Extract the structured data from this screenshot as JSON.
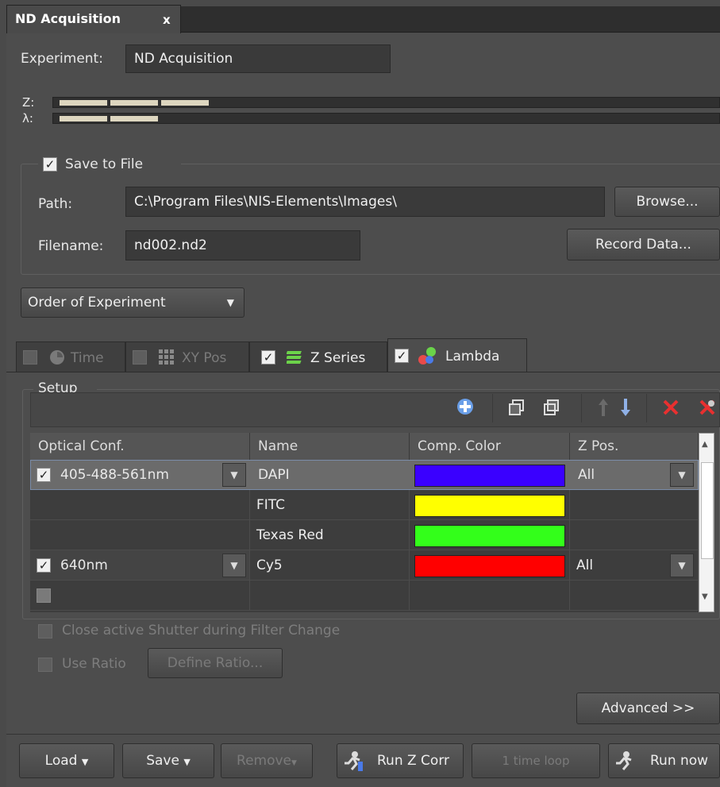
{
  "window": {
    "tab_title": "ND Acquisition",
    "tab_close": "x"
  },
  "experiment": {
    "label": "Experiment:",
    "value": "ND Acquisition"
  },
  "dims": {
    "z_label": "Z:",
    "lambda_label": "λ:"
  },
  "save": {
    "group_label": "Save to File",
    "checked": true,
    "path_label": "Path:",
    "path_value": "C:\\Program Files\\NIS-Elements\\Images\\",
    "browse": "Browse...",
    "filename_label": "Filename:",
    "filename_value": "nd002.nd2",
    "record": "Record Data..."
  },
  "order": {
    "label": "Order of Experiment"
  },
  "tabs": [
    {
      "label": "Time",
      "checked": false,
      "enabled": false
    },
    {
      "label": "XY Pos",
      "checked": false,
      "enabled": false
    },
    {
      "label": "Z Series",
      "checked": true,
      "enabled": true
    },
    {
      "label": "Lambda",
      "checked": true,
      "enabled": true
    }
  ],
  "setup": {
    "label": "Setup",
    "columns": [
      "Optical Conf.",
      "Name",
      "Comp. Color",
      "Z Pos."
    ],
    "rows": [
      {
        "conf": "405-488-561nm",
        "conf_checked": true,
        "name": "DAPI",
        "color": "#3a00ff",
        "zpos": "All"
      },
      {
        "conf": "",
        "name": "FITC",
        "color": "#ffff00",
        "zpos": ""
      },
      {
        "conf": "",
        "name": "Texas Red",
        "color": "#33ff1a",
        "zpos": ""
      },
      {
        "conf": "640nm",
        "conf_checked": true,
        "name": "Cy5",
        "color": "#ff0000",
        "zpos": "All"
      },
      {
        "conf": "",
        "conf_checked": false,
        "name": "",
        "color": "",
        "zpos": ""
      }
    ],
    "close_shutter": "Close active Shutter during Filter Change",
    "use_ratio": "Use Ratio",
    "define_ratio": "Define Ratio...",
    "advanced": "Advanced >>"
  },
  "footer": {
    "load": "Load",
    "save": "Save",
    "remove": "Remove",
    "run_z_corr": "Run Z Corr",
    "time_loop": "1 time loop",
    "run_now": "Run now"
  },
  "colors": {
    "bg": "#4d4d4d",
    "field": "#3a3a3a"
  }
}
